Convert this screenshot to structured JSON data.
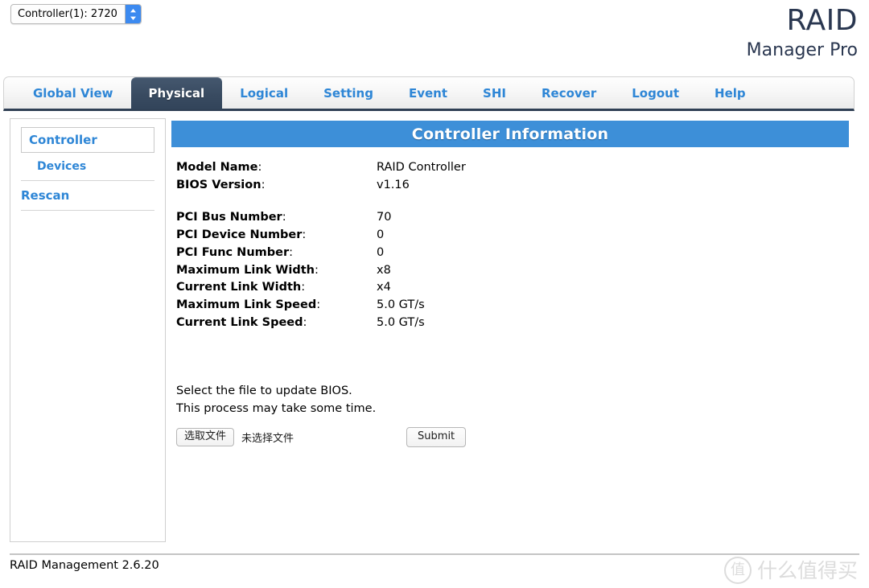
{
  "topbar": {
    "controller_select": {
      "value": "Controller(1): 2720",
      "arrow_icon": "chevron-updown-icon"
    },
    "brand": {
      "main": "RAID",
      "sub": "Manager Pro"
    }
  },
  "tabs": [
    {
      "label": "Global View",
      "active": false
    },
    {
      "label": "Physical",
      "active": true
    },
    {
      "label": "Logical",
      "active": false
    },
    {
      "label": "Setting",
      "active": false
    },
    {
      "label": "Event",
      "active": false
    },
    {
      "label": "SHI",
      "active": false
    },
    {
      "label": "Recover",
      "active": false
    },
    {
      "label": "Logout",
      "active": false
    },
    {
      "label": "Help",
      "active": false
    }
  ],
  "sidebar": {
    "selected": "Controller",
    "items": [
      {
        "label": "Controller",
        "style": "boxed"
      },
      {
        "label": "Devices",
        "style": "indent"
      },
      {
        "label": "Rescan",
        "style": "link"
      }
    ]
  },
  "main": {
    "panel_title": "Controller Information",
    "info_rows": [
      {
        "label": "Model Name",
        "value": "RAID Controller"
      },
      {
        "label": "BIOS Version",
        "value": "v1.16"
      },
      {
        "spacer": true
      },
      {
        "label": "PCI Bus Number",
        "value": "70"
      },
      {
        "label": "PCI Device Number",
        "value": "0"
      },
      {
        "label": "PCI Func Number",
        "value": "0"
      },
      {
        "label": "Maximum Link Width",
        "value": "x8"
      },
      {
        "label": "Current Link Width",
        "value": "x4"
      },
      {
        "label": "Maximum Link Speed",
        "value": "5.0 GT/s"
      },
      {
        "label": "Current Link Speed",
        "value": "5.0 GT/s"
      }
    ],
    "bios_update": {
      "line1": "Select the file to update BIOS.",
      "line2": "This process may take some time.",
      "choose_file_label": "选取文件",
      "no_file_label": "未选择文件",
      "submit_label": "Submit"
    }
  },
  "footer": {
    "text": "RAID Management 2.6.20",
    "watermark_badge": "值",
    "watermark_text": "什么值得买"
  },
  "colors": {
    "accent_blue": "#2e86d6",
    "panel_header": "#3d8fd8",
    "active_tab": "#394b61",
    "brand": "#2a3750"
  }
}
